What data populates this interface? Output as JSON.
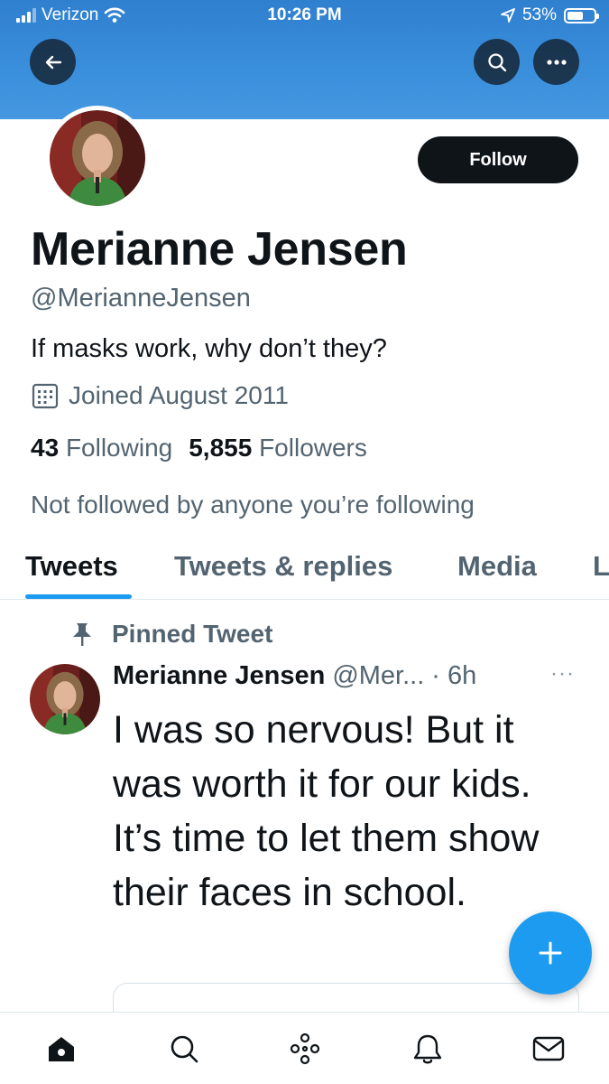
{
  "status_bar": {
    "carrier": "Verizon",
    "time": "10:26 PM",
    "battery": "53%"
  },
  "header": {
    "back_icon": "arrow-left-icon",
    "search_icon": "search-icon",
    "more_icon": "more-horizontal-icon"
  },
  "profile": {
    "follow_label": "Follow",
    "name": "Merianne Jensen",
    "handle": "@MerianneJensen",
    "bio": "If masks work, why don’t they?",
    "joined": "Joined August 2011",
    "following_count": "43",
    "following_label": "Following",
    "followers_count": "5,855",
    "followers_label": "Followers",
    "not_followed": "Not followed by anyone you’re following"
  },
  "tabs": [
    {
      "label": "Tweets",
      "active": true
    },
    {
      "label": "Tweets & replies",
      "active": false
    },
    {
      "label": "Media",
      "active": false
    },
    {
      "label": "L",
      "active": false
    }
  ],
  "pinned_tweet": {
    "pinned_label": "Pinned Tweet",
    "author_name": "Merianne Jensen",
    "author_handle": "@Mer...",
    "separator": "·",
    "time": "6h",
    "more": "···",
    "text": "I was so nervous! But it was worth it for our kids. It’s time to let them show their faces in school."
  },
  "fab": {
    "icon": "compose-plus-icon"
  },
  "bottom_nav": [
    "home-icon",
    "search-icon",
    "spaces-icon",
    "notifications-bell-icon",
    "messages-mail-icon"
  ],
  "colors": {
    "banner": "#3a8fdc",
    "accent": "#1d9bf0",
    "text": "#0f1419",
    "secondary": "#536471"
  }
}
